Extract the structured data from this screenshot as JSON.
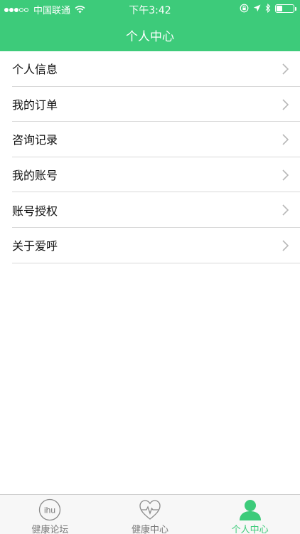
{
  "status_bar": {
    "carrier": "中国联通",
    "time": "下午3:42",
    "signal_bars_on": 3,
    "signal_bars_total": 5,
    "battery_level": 0.35
  },
  "header": {
    "title": "个人中心",
    "background_color": "#3dcb7a"
  },
  "menu": {
    "items": [
      {
        "label": "个人信息"
      },
      {
        "label": "我的订单"
      },
      {
        "label": "咨询记录"
      },
      {
        "label": "我的账号"
      },
      {
        "label": "账号授权"
      },
      {
        "label": "关于爱呼"
      }
    ]
  },
  "tabbar": {
    "tabs": [
      {
        "label": "健康论坛",
        "icon": "ihu-logo-icon",
        "icon_text": "ihu",
        "active": false
      },
      {
        "label": "健康中心",
        "icon": "heart-pulse-icon",
        "active": false
      },
      {
        "label": "个人中心",
        "icon": "person-icon",
        "active": true
      }
    ],
    "active_color": "#3dcb7a",
    "inactive_color": "#7a7a7a"
  }
}
